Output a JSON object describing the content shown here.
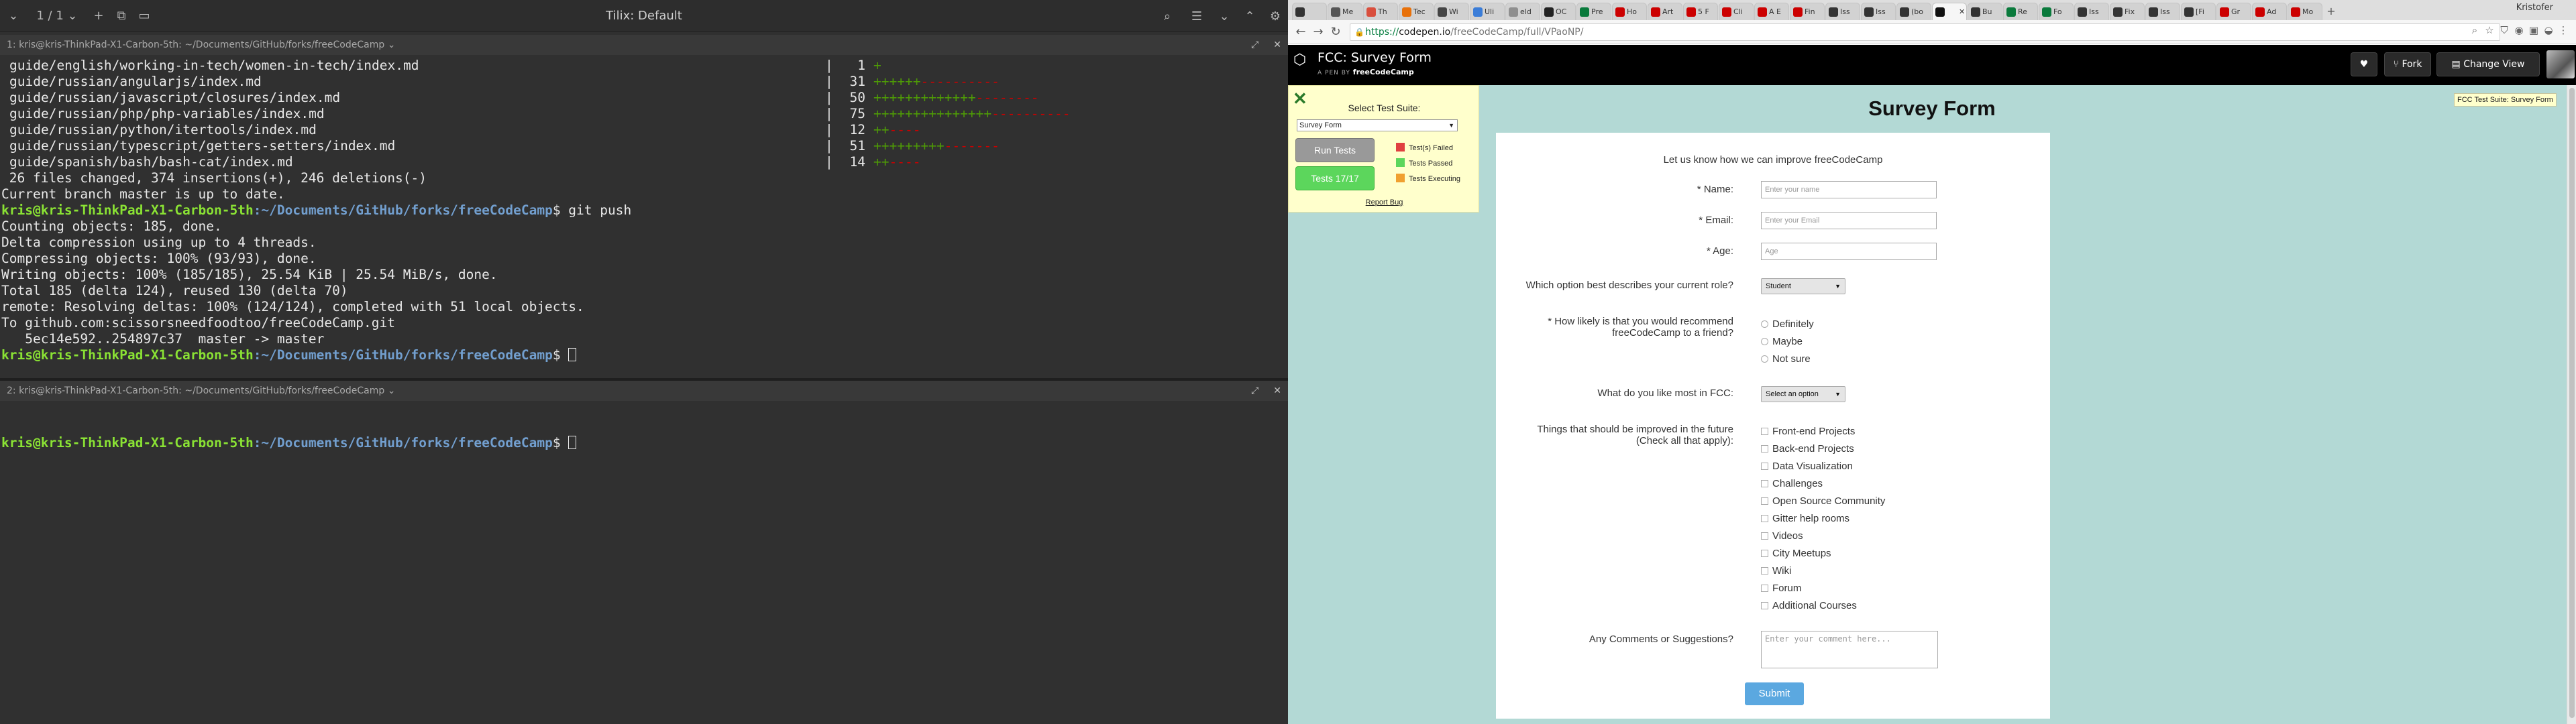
{
  "tilix": {
    "title": "Tilix: Default",
    "session_label": "1 / 1",
    "pane1_title": "1: kris@kris-ThinkPad-X1-Carbon-5th: ~/Documents/GitHub/forks/freeCodeCamp",
    "pane2_title": "2: kris@kris-ThinkPad-X1-Carbon-5th: ~/Documents/GitHub/forks/freeCodeCamp",
    "prompt_user": "kris@kris-ThinkPad-X1-Carbon-5th",
    "prompt_path": ":~/Documents/GitHub/forks/freeCodeCamp",
    "prompt_sign": "$ ",
    "diffstat": [
      {
        "file": "guide/english/working-in-tech/women-in-tech/index.md",
        "count": "1",
        "plus": "+",
        "minus": ""
      },
      {
        "file": "guide/russian/angularjs/index.md",
        "count": "31",
        "plus": "++++++",
        "minus": "----------"
      },
      {
        "file": "guide/russian/javascript/closures/index.md",
        "count": "50",
        "plus": "+++++++++++++",
        "minus": "--------"
      },
      {
        "file": "guide/russian/php/php-variables/index.md",
        "count": "75",
        "plus": "+++++++++++++++",
        "minus": "----------"
      },
      {
        "file": "guide/russian/python/itertools/index.md",
        "count": "12",
        "plus": "++",
        "minus": "----"
      },
      {
        "file": "guide/russian/typescript/getters-setters/index.md",
        "count": "51",
        "plus": "+++++++++",
        "minus": "-------"
      },
      {
        "file": "guide/spanish/bash/bash-cat/index.md",
        "count": "14",
        "plus": "++",
        "minus": "----"
      }
    ],
    "summary": " 26 files changed, 374 insertions(+), 246 deletions(-)",
    "uptodate": "Current branch master is up to date.",
    "command": "git push",
    "push_output": [
      "Counting objects: 185, done.",
      "Delta compression using up to 4 threads.",
      "Compressing objects: 100% (93/93), done.",
      "Writing objects: 100% (185/185), 25.54 KiB | 25.54 MiB/s, done.",
      "Total 185 (delta 124), reused 130 (delta 70)",
      "remote: Resolving deltas: 100% (124/124), completed with 51 local objects.",
      "To github.com:scissorsneedfoodtoo/freeCodeCamp.git",
      "   5ec14e592..254897c37  master -> master"
    ]
  },
  "browser": {
    "profile": "Kristofer",
    "url_scheme": "https://",
    "url_host": "codepen.io",
    "url_path": "/freeCodeCamp/full/VPaoNP/",
    "tabs": [
      {
        "label": "",
        "color": "#333333",
        "active": false
      },
      {
        "label": "Me",
        "color": "#555555",
        "active": false
      },
      {
        "label": "Th",
        "color": "#d94f3d",
        "active": false
      },
      {
        "label": "Tec",
        "color": "#e8710a",
        "active": false
      },
      {
        "label": "Wi",
        "color": "#444444",
        "active": false
      },
      {
        "label": "Uli",
        "color": "#3b7dd8",
        "active": false
      },
      {
        "label": "eld",
        "color": "#8f8f8f",
        "active": false
      },
      {
        "label": "OC",
        "color": "#222222",
        "active": false
      },
      {
        "label": "Pre",
        "color": "#0a7a3c",
        "active": false
      },
      {
        "label": "Ho",
        "color": "#cc0000",
        "active": false
      },
      {
        "label": "Art",
        "color": "#cc0000",
        "active": false
      },
      {
        "label": "5 F",
        "color": "#cc0000",
        "active": false
      },
      {
        "label": "Cli",
        "color": "#cc0000",
        "active": false
      },
      {
        "label": "A E",
        "color": "#cc0000",
        "active": false
      },
      {
        "label": "Fin",
        "color": "#cc0000",
        "active": false
      },
      {
        "label": "Iss",
        "color": "#333333",
        "active": false
      },
      {
        "label": "Iss",
        "color": "#333333",
        "active": false
      },
      {
        "label": "(bo",
        "color": "#333333",
        "active": false
      },
      {
        "label": "",
        "color": "#111111",
        "active": true
      },
      {
        "label": "Bu",
        "color": "#333333",
        "active": false
      },
      {
        "label": "Re",
        "color": "#0a7a3c",
        "active": false
      },
      {
        "label": "Fo",
        "color": "#0a7a3c",
        "active": false
      },
      {
        "label": "Iss",
        "color": "#333333",
        "active": false
      },
      {
        "label": "Fix",
        "color": "#333333",
        "active": false
      },
      {
        "label": "Iss",
        "color": "#333333",
        "active": false
      },
      {
        "label": "[Fi",
        "color": "#333333",
        "active": false
      },
      {
        "label": "Gr",
        "color": "#cc0000",
        "active": false
      },
      {
        "label": "Ad",
        "color": "#cc0000",
        "active": false
      },
      {
        "label": "Mo",
        "color": "#cc0000",
        "active": false
      }
    ]
  },
  "codepen": {
    "title": "FCC: Survey Form",
    "by_label": "A PEN BY",
    "author": "freeCodeCamp",
    "fork_label": "Fork",
    "change_view_label": "Change View"
  },
  "test_panel": {
    "select_label": "Select Test Suite:",
    "selected_suite": "Survey Form",
    "run_label": "Run Tests",
    "tests_label": "Tests 17/17",
    "legend_failed": "Test(s) Failed",
    "legend_passed": "Tests Passed",
    "legend_executing": "Tests Executing",
    "color_failed": "#e04040",
    "color_passed": "#5cd65c",
    "color_executing": "#f0a030",
    "report_bug": "Report Bug",
    "tooltip": "FCC Test Suite: Survey Form"
  },
  "survey": {
    "title": "Survey Form",
    "intro": "Let us know how we can improve freeCodeCamp",
    "name_label": "Name:",
    "name_placeholder": "Enter your name",
    "email_label": "Email:",
    "email_placeholder": "Enter your Email",
    "age_label": "Age:",
    "age_placeholder": "Age",
    "role_label": "Which option best describes your current role?",
    "role_value": "Student",
    "recommend_label_1": "How likely is that you would recommend",
    "recommend_label_2": "freeCodeCamp to a friend?",
    "recommend_options": [
      "Definitely",
      "Maybe",
      "Not sure"
    ],
    "like_label": "What do you like most in FCC:",
    "like_value": "Select an option",
    "improve_label_1": "Things that should be improved in the future",
    "improve_label_2": "(Check all that apply):",
    "improve_options": [
      "Front-end Projects",
      "Back-end Projects",
      "Data Visualization",
      "Challenges",
      "Open Source Community",
      "Gitter help rooms",
      "Videos",
      "City Meetups",
      "Wiki",
      "Forum",
      "Additional Courses"
    ],
    "comments_label": "Any Comments or Suggestions?",
    "comments_placeholder": "Enter your comment here...",
    "submit_label": "Submit"
  }
}
